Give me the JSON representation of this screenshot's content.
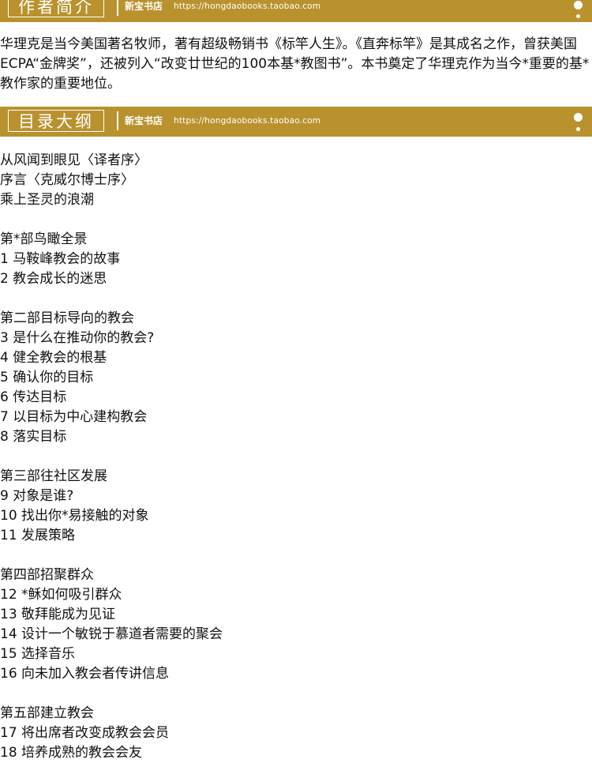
{
  "shop_name": "新宝书店",
  "shop_url": "https://hongdaobooks.taobao.com",
  "author_section": {
    "title": "作者简介",
    "text": "华理克是当今美国著名牧师，著有超级畅销书《标竿人生》。《直奔标竿》是其成名之作，曾获美国ECPA“金牌奖”，还被列入“改变廿世纪的100本基*教图书”。本书奠定了华理克作为当今*重要的基*教作家的重要地位。"
  },
  "toc_section": {
    "title": "目录大纲",
    "lines": [
      "从风闻到眼见〈译者序〉",
      "序言〈克威尔博士序〉",
      "乘上圣灵的浪潮",
      "",
      "第*部鸟瞰全景",
      "1 马鞍峰教会的故事",
      "2 教会成长的迷思",
      "",
      "第二部目标导向的教会",
      "3 是什么在推动你的教会?",
      "4 健全教会的根基",
      "5 确认你的目标",
      "6 传达目标",
      "7 以目标为中心建构教会",
      "8 落实目标",
      "",
      "第三部往社区发展",
      "9 对象是谁?",
      "10 找出你*易接触的对象",
      "11 发展策略",
      "",
      "第四部招聚群众",
      "12 *稣如何吸引群众",
      "13 敬拜能成为见证",
      "14 设计一个敏锐于慕道者需要的聚会",
      "15 选择音乐",
      "16 向未加入教会者传讲信息",
      "",
      "第五部建立教会",
      "17 将出席者改变成教会会员",
      "18 培养成熟的教会会友"
    ]
  }
}
